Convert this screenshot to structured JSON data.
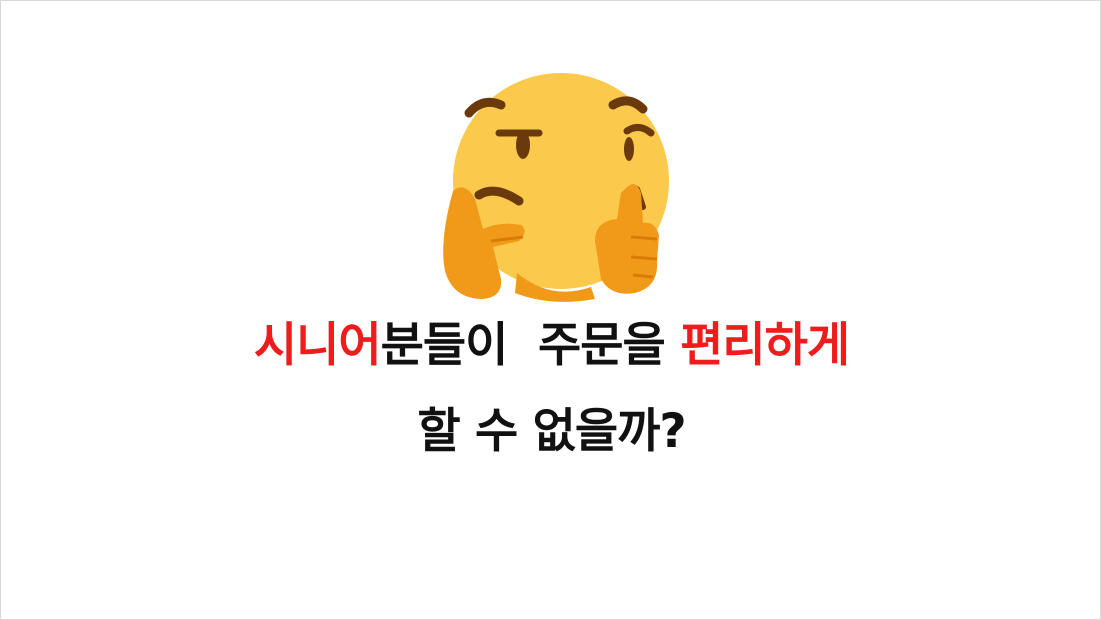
{
  "headline": {
    "line1": [
      {
        "text": "시니어",
        "color": "#ee1c1c"
      },
      {
        "text": "분들이  주문을 ",
        "color": "#111111"
      },
      {
        "text": "편리하게",
        "color": "#ee1c1c"
      }
    ],
    "line2": [
      {
        "text": "할 수 없을까?",
        "color": "#111111"
      }
    ]
  },
  "illustration": {
    "icon": "thinking-face-icon",
    "face_color": "#fbc94c",
    "hand_color": "#f19a1a",
    "feature_color": "#6b3a0c"
  }
}
